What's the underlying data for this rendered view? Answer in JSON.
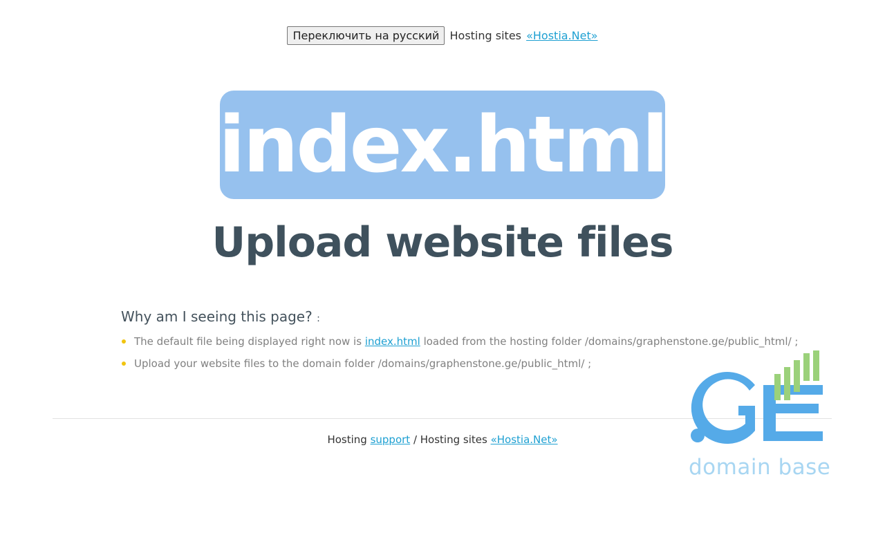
{
  "topbar": {
    "switch_button": "Переключить на русский",
    "hosting_sites_text": "Hosting sites",
    "hostia_link": "«Hostia.Net»"
  },
  "logo_text": "index.html",
  "headline": "Upload website files",
  "why": {
    "question": "Why am I seeing this page?",
    "colon": ":"
  },
  "items": [
    {
      "before": "The default file being displayed right now is ",
      "link": "index.html",
      "after": " loaded from the hosting folder /domains/graphenstone.ge/public_html/ ;"
    },
    {
      "text": "Upload your website files to the domain folder /domains/graphenstone.ge/public_html/ ;"
    }
  ],
  "footer": {
    "hosting_text": "Hosting",
    "support_link": "support",
    "separator_text": "/ Hosting sites",
    "hostia_link": "«Hostia.Net»"
  },
  "ge_logo": {
    "mark": ".GE",
    "tagline": "domain base"
  },
  "colors": {
    "link": "#1ea0d2",
    "logo_box": "#96c1ee",
    "headline": "#3f515d",
    "bullet": "#f1c40f",
    "ge_blue": "#55aae8",
    "ge_green": "#9bd17a"
  }
}
